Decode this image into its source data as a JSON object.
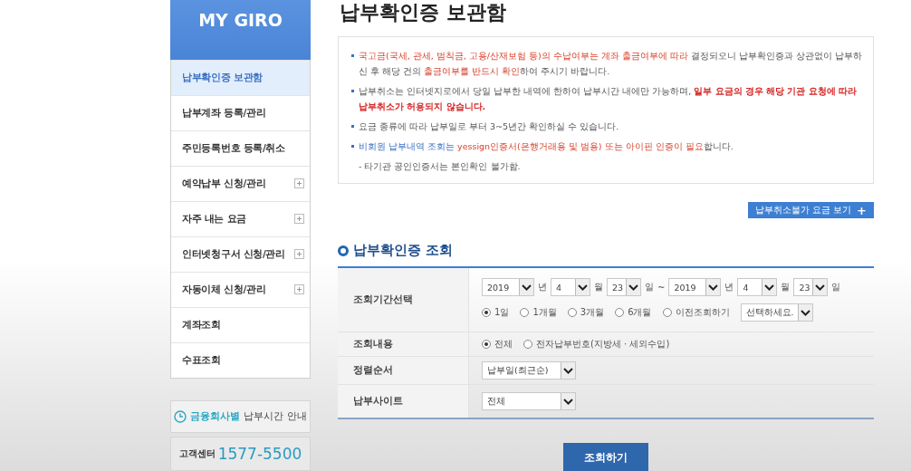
{
  "sidebar": {
    "title": "MY GIRO",
    "items": [
      {
        "label": "납부확인증 보관함",
        "selected": true,
        "expandable": false
      },
      {
        "label": "납부계좌 등록/관리",
        "selected": false,
        "expandable": false
      },
      {
        "label": "주민등록번호 등록/취소",
        "selected": false,
        "expandable": false
      },
      {
        "label": "예약납부 신청/관리",
        "selected": false,
        "expandable": true
      },
      {
        "label": "자주 내는 요금",
        "selected": false,
        "expandable": true
      },
      {
        "label": "인터넷청구서 신청/관리",
        "selected": false,
        "expandable": true
      },
      {
        "label": "자동이체 신청/관리",
        "selected": false,
        "expandable": true
      },
      {
        "label": "계좌조회",
        "selected": false,
        "expandable": false
      },
      {
        "label": "수표조회",
        "selected": false,
        "expandable": false
      }
    ],
    "time_guide": {
      "highlight": "금융회사별",
      "rest": "납부시간 안내"
    },
    "customer_center": {
      "label": "고객센터",
      "phone": "1577-5500"
    }
  },
  "page_title": "납부확인증 보관함",
  "notices": [
    {
      "kind": "bullet",
      "segments": [
        {
          "kind": "warning",
          "text": "국고금(국세, 관세, 범칙금, 고용/산재보험 등)의 수납여부는 계좌 출금여부에 따라"
        },
        {
          "kind": "plain",
          "text": " 결정되오니 납부확인증과 상관없이 납부하신 후 해당 건의 "
        },
        {
          "kind": "warning",
          "text": "출금여부를 반드시 확인"
        },
        {
          "kind": "plain",
          "text": "하여 주시기 바랍니다."
        }
      ]
    },
    {
      "kind": "bullet",
      "segments": [
        {
          "kind": "plain",
          "text": "납부취소는 인터넷지로에서 당일 납부한 내역에 한하여 납부시간 내에만 가능하며, "
        },
        {
          "kind": "strong",
          "text": "일부 요금의 경우 해당 기관 요청에 따라 납부취소가 허용되지 않습니다."
        }
      ]
    },
    {
      "kind": "bullet",
      "segments": [
        {
          "kind": "plain",
          "text": "요금 종류에 따라 납부일로 부터 3~5년간 확인하실 수 있습니다."
        }
      ]
    },
    {
      "kind": "bullet",
      "segments": [
        {
          "kind": "info",
          "text": "비회원 납부내역 조회는"
        },
        {
          "kind": "warning",
          "text": " yessign인증서(은행거래용 및 범용) 또는 아이핀 인증이 필요"
        },
        {
          "kind": "plain",
          "text": "합니다."
        }
      ]
    },
    {
      "kind": "note",
      "segments": [
        {
          "kind": "plain",
          "text": "- 타기관 공인인증서는 본인확인 불가함."
        }
      ]
    }
  ],
  "view_button": {
    "label": "납부취소불가 요금 보기",
    "icon": "+"
  },
  "section_title": "납부확인증 조회",
  "form": {
    "rows": [
      {
        "kind": "period",
        "label": "조회기간선택",
        "dates": [
          {
            "year": "2019",
            "year_unit": "년",
            "month": "4",
            "month_unit": "월",
            "day": "23",
            "day_unit": "일"
          },
          {
            "year": "2019",
            "year_unit": "년",
            "month": "4",
            "month_unit": "월",
            "day": "23",
            "day_unit": "일"
          }
        ],
        "separator": "~",
        "options": [
          {
            "label": "1일",
            "selected": true
          },
          {
            "label": "1개월",
            "selected": false
          },
          {
            "label": "3개월",
            "selected": false
          },
          {
            "label": "6개월",
            "selected": false
          },
          {
            "label": "이전조회하기",
            "selected": false
          }
        ],
        "history_select": "선택하세요."
      },
      {
        "kind": "radios",
        "label": "조회내용",
        "options": [
          {
            "label": "전체",
            "selected": true
          },
          {
            "label": "전자납부번호(지방세 · 세외수입)",
            "selected": false
          }
        ]
      },
      {
        "kind": "select",
        "label": "정렬순서",
        "value": "납부일(최근순)"
      },
      {
        "kind": "select",
        "label": "납부사이트",
        "value": "전체"
      }
    ]
  },
  "search_button": "조회하기"
}
